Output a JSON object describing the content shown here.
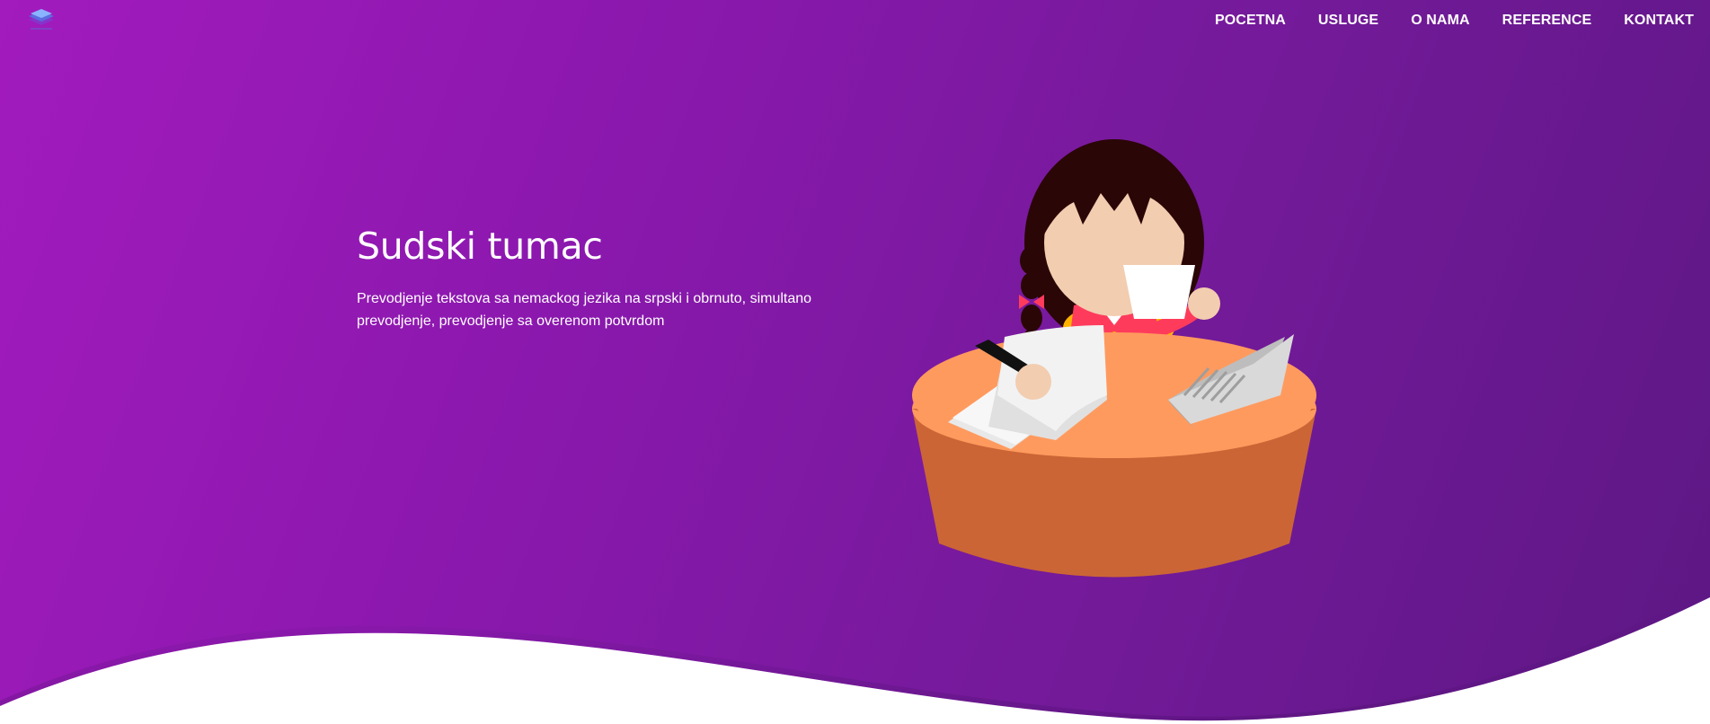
{
  "brand": {
    "logo_icon": "layers-icon"
  },
  "nav": {
    "items": [
      {
        "label": "POCETNA"
      },
      {
        "label": "USLUGE"
      },
      {
        "label": "O NAMA"
      },
      {
        "label": "REFERENCE"
      },
      {
        "label": "KONTAKT"
      }
    ]
  },
  "hero": {
    "title": "Sudski tumac",
    "subtitle": "Prevodjenje tekstova sa nemackog jezika na srpski i obrnuto, simultano prevodjenje, prevodjenje sa overenom potvrdom",
    "illustration_icon": "translator-at-desk-illustration"
  },
  "colors": {
    "gradient_start": "#a21bbd",
    "gradient_end": "#5d1784",
    "desk": "#cc6535",
    "desk_top": "#ff9a5e",
    "text": "#ffffff"
  }
}
